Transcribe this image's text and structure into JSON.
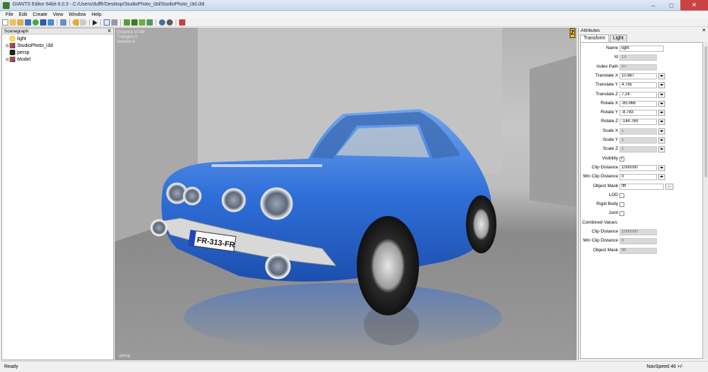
{
  "window": {
    "title": "GIANTS Editor 64bit 6.0.3 - C:/Users/dufffr/Desktop/StudioPhoto_i3d/StudioPhoto_i3d.i3d",
    "minimize": "–",
    "maximize": "□",
    "close": "✕"
  },
  "menu": {
    "items": [
      "File",
      "Edit",
      "Create",
      "View",
      "Window",
      "Help"
    ]
  },
  "toolbar": {
    "icons": [
      "new-file-icon",
      "open-folder-icon",
      "open-recent-icon",
      "save-icon",
      "refresh-icon",
      "save-as-icon",
      "export-icon",
      "import-icon",
      "undo-icon",
      "redo-icon",
      "play-icon",
      "select-tool-icon",
      "lock-icon",
      "terrain-paint-icon",
      "terrain-height-icon",
      "foliage-icon",
      "vertex-paint-icon",
      "settings-gear-icon",
      "plugin-gear-icon",
      "record-icon"
    ]
  },
  "scenegraph": {
    "title": "Scenegraph",
    "close": "✕",
    "nodes": [
      {
        "label": "light",
        "expand": "",
        "icon": "light-bulb-icon"
      },
      {
        "label": "StudioPhoto_i3d",
        "expand": "⊞",
        "icon": "transform-group-icon"
      },
      {
        "label": "persp",
        "expand": "",
        "icon": "camera-icon"
      },
      {
        "label": "Model",
        "expand": "⊞",
        "icon": "transform-group-icon"
      }
    ]
  },
  "viewport": {
    "stats": [
      "Distance 10.88",
      "Triangles 0",
      "Vertices 0"
    ],
    "camera_label": "persp",
    "license_plate": "FR-313-FR"
  },
  "gizmo": {
    "label": "Z"
  },
  "attributes": {
    "title": "Attributes",
    "close": "✕",
    "tabs": [
      "Transform",
      "Light"
    ],
    "rows": [
      {
        "label": "Name",
        "value": "light",
        "kind": "field"
      },
      {
        "label": "Id",
        "value": "13",
        "kind": "ro"
      },
      {
        "label": "Index Path",
        "value": "0>",
        "kind": "ro"
      },
      {
        "label": "Translate X",
        "value": "10.887",
        "kind": "spin"
      },
      {
        "label": "Translate Y",
        "value": "4.795",
        "kind": "spin"
      },
      {
        "label": "Translate Z",
        "value": "7.24",
        "kind": "spin"
      },
      {
        "label": "Rotate X",
        "value": "-85.966",
        "kind": "spin"
      },
      {
        "label": "Rotate Y",
        "value": "-8.783",
        "kind": "spin"
      },
      {
        "label": "Rotate Z",
        "value": "-144.789",
        "kind": "spin"
      },
      {
        "label": "Scale X",
        "value": "1",
        "kind": "ro-spin"
      },
      {
        "label": "Scale Y",
        "value": "1",
        "kind": "ro-spin"
      },
      {
        "label": "Scale Z",
        "value": "1",
        "kind": "ro-spin"
      },
      {
        "label": "Visibility",
        "value": "✓",
        "kind": "check"
      },
      {
        "label": "Clip Distance",
        "value": "1000000",
        "kind": "spin"
      },
      {
        "label": "Min Clip Distance",
        "value": "0",
        "kind": "spin"
      },
      {
        "label": "Object Mask",
        "value": "ffff",
        "kind": "dots",
        "button": "..."
      },
      {
        "label": "LOD",
        "value": "",
        "kind": "check"
      },
      {
        "label": "Rigid Body",
        "value": "",
        "kind": "check"
      },
      {
        "label": "Joint",
        "value": "",
        "kind": "check"
      },
      {
        "label": "Combined Values",
        "value": "",
        "kind": "section"
      },
      {
        "label": "Clip Distance",
        "value": "1000000",
        "kind": "ro"
      },
      {
        "label": "Min Clip Distance",
        "value": "0",
        "kind": "ro"
      },
      {
        "label": "Object Mask",
        "value": "ffff",
        "kind": "ro"
      }
    ]
  },
  "status": {
    "left": "Ready",
    "right": "NavSpeed 46 +/-"
  }
}
